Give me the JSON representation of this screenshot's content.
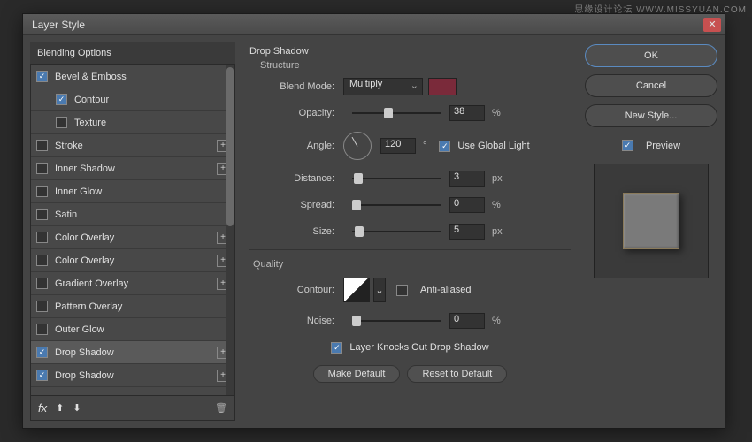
{
  "watermark": "思缘设计论坛  WWW.MISSYUAN.COM",
  "window": {
    "title": "Layer Style"
  },
  "left": {
    "header": "Blending Options",
    "effects": [
      {
        "label": "Bevel & Emboss",
        "checked": true,
        "plus": false,
        "sub": false
      },
      {
        "label": "Contour",
        "checked": true,
        "plus": false,
        "sub": true
      },
      {
        "label": "Texture",
        "checked": false,
        "plus": false,
        "sub": true
      },
      {
        "label": "Stroke",
        "checked": false,
        "plus": true,
        "sub": false
      },
      {
        "label": "Inner Shadow",
        "checked": false,
        "plus": true,
        "sub": false
      },
      {
        "label": "Inner Glow",
        "checked": false,
        "plus": false,
        "sub": false
      },
      {
        "label": "Satin",
        "checked": false,
        "plus": false,
        "sub": false
      },
      {
        "label": "Color Overlay",
        "checked": false,
        "plus": true,
        "sub": false
      },
      {
        "label": "Color Overlay",
        "checked": false,
        "plus": true,
        "sub": false
      },
      {
        "label": "Gradient Overlay",
        "checked": false,
        "plus": true,
        "sub": false
      },
      {
        "label": "Pattern Overlay",
        "checked": false,
        "plus": false,
        "sub": false
      },
      {
        "label": "Outer Glow",
        "checked": false,
        "plus": false,
        "sub": false
      },
      {
        "label": "Drop Shadow",
        "checked": true,
        "plus": true,
        "sub": false,
        "selected": true
      },
      {
        "label": "Drop Shadow",
        "checked": true,
        "plus": true,
        "sub": false
      }
    ]
  },
  "center": {
    "title": "Drop Shadow",
    "structure": "Structure",
    "blendModeLabel": "Blend Mode:",
    "blendMode": "Multiply",
    "opacityLabel": "Opacity:",
    "opacity": "38",
    "opacityUnit": "%",
    "angleLabel": "Angle:",
    "angle": "120",
    "angleUnit": "°",
    "globalLight": "Use Global Light",
    "distanceLabel": "Distance:",
    "distance": "3",
    "distanceUnit": "px",
    "spreadLabel": "Spread:",
    "spread": "0",
    "spreadUnit": "%",
    "sizeLabel": "Size:",
    "size": "5",
    "sizeUnit": "px",
    "quality": "Quality",
    "contourLabel": "Contour:",
    "antiAliased": "Anti-aliased",
    "noiseLabel": "Noise:",
    "noise": "0",
    "noiseUnit": "%",
    "knockout": "Layer Knocks Out Drop Shadow",
    "makeDefault": "Make Default",
    "resetDefault": "Reset to Default"
  },
  "right": {
    "ok": "OK",
    "cancel": "Cancel",
    "newStyle": "New Style...",
    "preview": "Preview"
  }
}
